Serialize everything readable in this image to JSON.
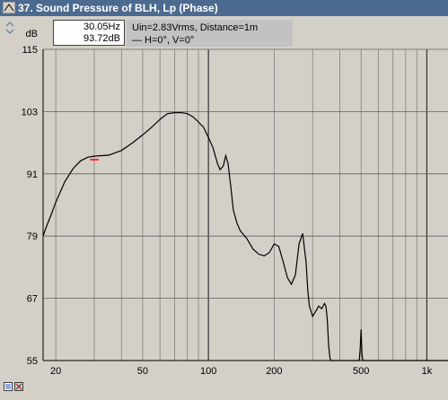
{
  "window": {
    "title": "37. Sound Pressure of BLH, Lp (Phase)",
    "icon": "triangle-icon"
  },
  "readout": {
    "freq": "30.05Hz",
    "level": "93.72dB"
  },
  "info": {
    "line1": "Uin=2.83Vrms, Distance=1m",
    "line2": "— H=0°, V=0°"
  },
  "statusbar": {
    "icons": [
      "page-icon",
      "settings-icon"
    ]
  },
  "colors": {
    "background": "#d4d0c8",
    "title_bar": "#4c6a8f",
    "curve": "#000000",
    "cursor": "#ff0000",
    "grid": "#808080"
  },
  "chart_data": {
    "type": "line",
    "xscale": "log",
    "xlim": [
      17.5,
      1250
    ],
    "ylim": [
      55,
      115
    ],
    "ylabel": "dB",
    "yticks": [
      55,
      67,
      79,
      91,
      103,
      115
    ],
    "xticks": [
      {
        "value": 20,
        "label": "20"
      },
      {
        "value": 50,
        "label": "50"
      },
      {
        "value": 100,
        "label": "100"
      },
      {
        "value": 200,
        "label": "200"
      },
      {
        "value": 500,
        "label": "500"
      },
      {
        "value": 1000,
        "label": "1k"
      }
    ],
    "grid": true,
    "cursor": {
      "x": 30.05,
      "y": 93.72
    },
    "series": [
      {
        "x": [
          17.5,
          18,
          19,
          20,
          22,
          24,
          26,
          28,
          30,
          32,
          35,
          40,
          45,
          50,
          55,
          60,
          65,
          70,
          75,
          80,
          85,
          90,
          95,
          100,
          105,
          110,
          113,
          117,
          120,
          123,
          127,
          130,
          135,
          140,
          150,
          160,
          170,
          180,
          190,
          200,
          210,
          220,
          230,
          240,
          250,
          260,
          270,
          280,
          285,
          290,
          300,
          310,
          320,
          330,
          340,
          345,
          350,
          355,
          360,
          363,
          380,
          420,
          470,
          490,
          495,
          500,
          505,
          510,
          600,
          800,
          1000,
          1250
        ],
        "y": [
          79.0,
          80.5,
          83.0,
          85.5,
          89.5,
          92.0,
          93.5,
          94.2,
          94.4,
          94.5,
          94.6,
          95.5,
          97.0,
          98.5,
          100.0,
          101.5,
          102.6,
          102.8,
          102.8,
          102.6,
          102.0,
          101.0,
          100.0,
          98.0,
          96.0,
          93.0,
          91.8,
          92.5,
          94.5,
          93.0,
          88.0,
          84.0,
          81.5,
          80.0,
          78.5,
          76.5,
          75.5,
          75.2,
          75.8,
          77.5,
          77.0,
          74.0,
          71.0,
          69.7,
          71.5,
          77.5,
          79.5,
          74.0,
          68.5,
          65.5,
          63.5,
          64.5,
          65.5,
          65.0,
          66.0,
          65.5,
          63.0,
          58.0,
          55.5,
          54.5,
          54.5,
          54.5,
          54.5,
          54.5,
          57.0,
          61.0,
          56.0,
          54.5,
          54.5,
          54.5,
          54.5,
          54.5
        ]
      }
    ]
  }
}
